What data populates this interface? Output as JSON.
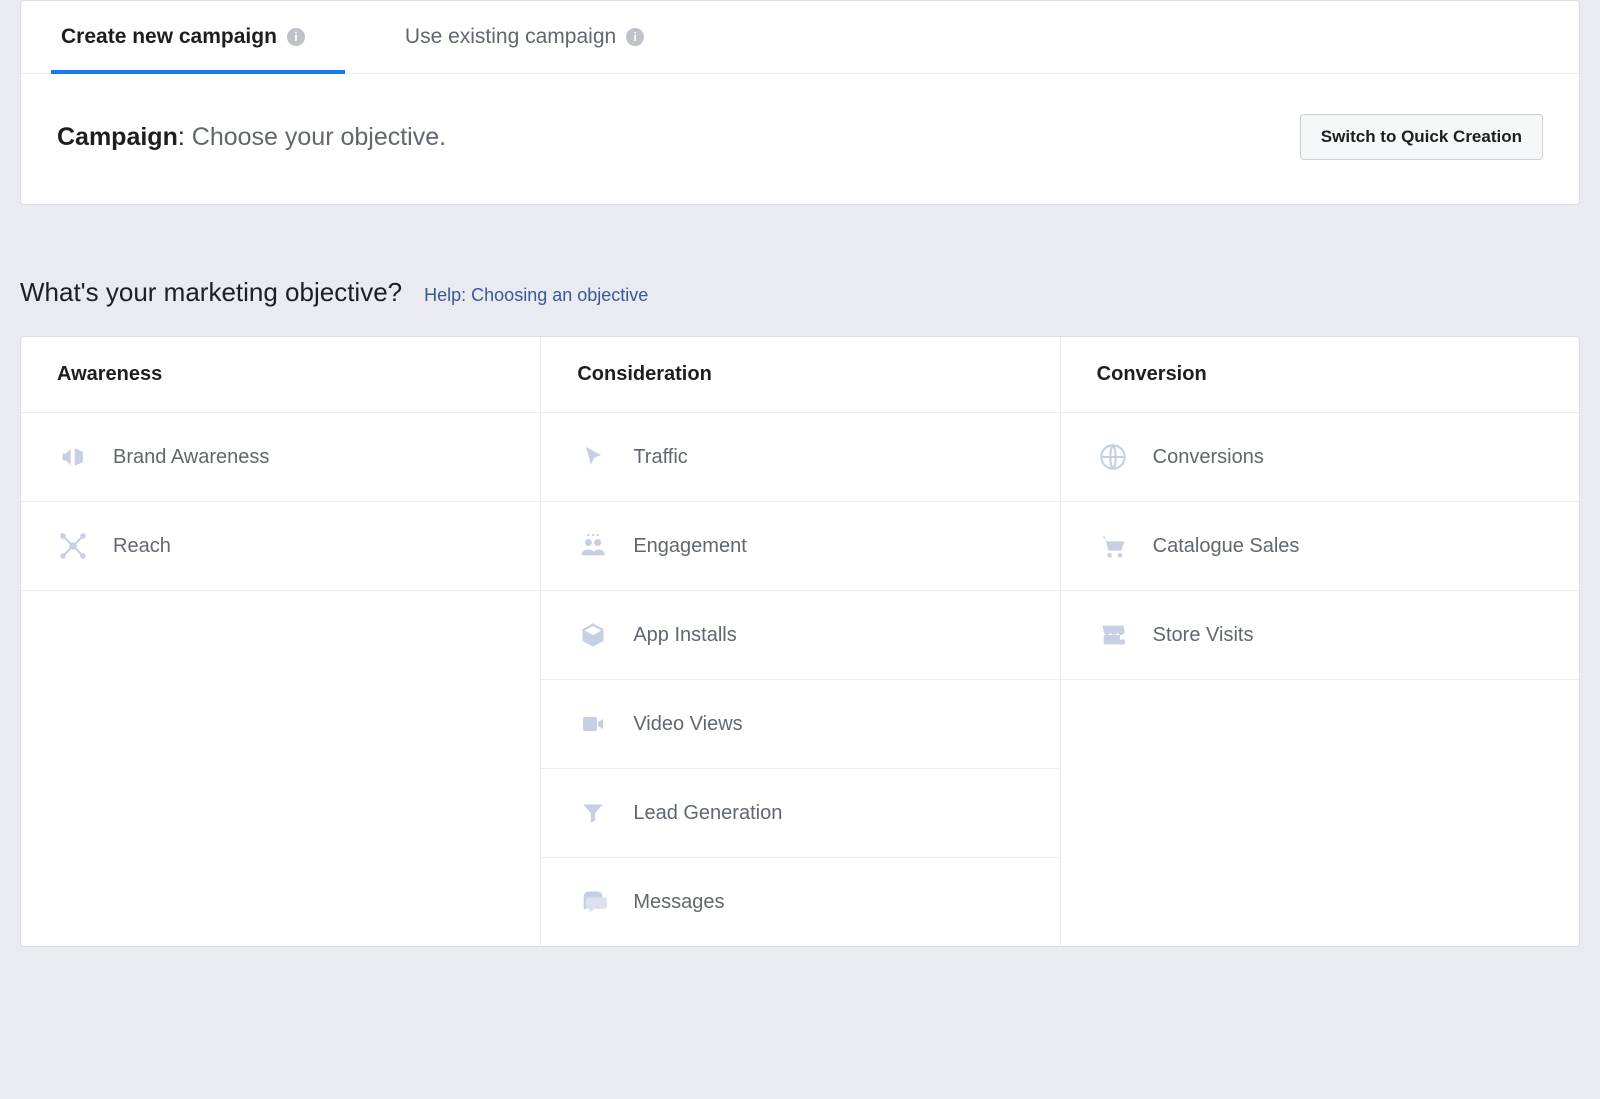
{
  "tabs": {
    "create": "Create new campaign",
    "existing": "Use existing campaign"
  },
  "campaign": {
    "label": "Campaign",
    "subtitle": "Choose your objective.",
    "switch_button": "Switch to Quick Creation"
  },
  "question": "What's your marketing objective?",
  "help_link": "Help: Choosing an objective",
  "columns": {
    "awareness": {
      "header": "Awareness",
      "items": [
        {
          "icon": "megaphone-icon",
          "label": "Brand Awareness"
        },
        {
          "icon": "reach-icon",
          "label": "Reach"
        }
      ]
    },
    "consideration": {
      "header": "Consideration",
      "items": [
        {
          "icon": "cursor-icon",
          "label": "Traffic"
        },
        {
          "icon": "people-icon",
          "label": "Engagement"
        },
        {
          "icon": "box-icon",
          "label": "App Installs"
        },
        {
          "icon": "video-icon",
          "label": "Video Views"
        },
        {
          "icon": "funnel-icon",
          "label": "Lead Generation"
        },
        {
          "icon": "chat-icon",
          "label": "Messages"
        }
      ]
    },
    "conversion": {
      "header": "Conversion",
      "items": [
        {
          "icon": "globe-icon",
          "label": "Conversions"
        },
        {
          "icon": "cart-icon",
          "label": "Catalogue Sales"
        },
        {
          "icon": "store-icon",
          "label": "Store Visits"
        }
      ]
    }
  }
}
